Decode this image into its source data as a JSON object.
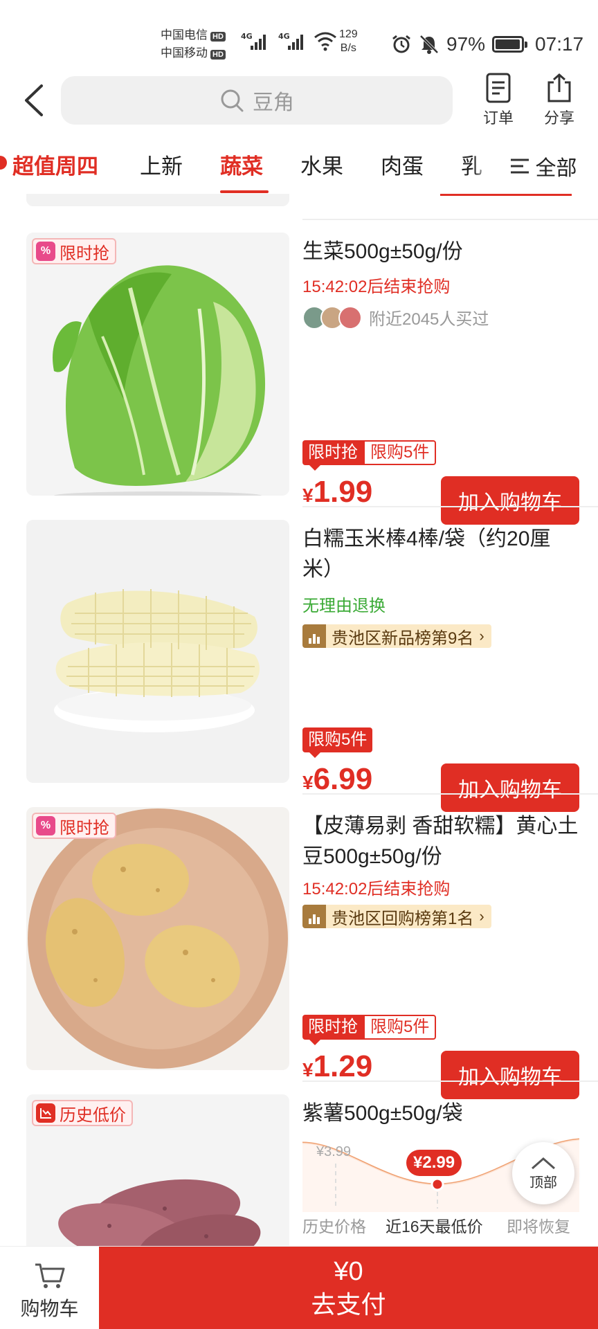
{
  "status": {
    "carrier1": "中国电信",
    "carrier2": "中国移动",
    "hd": "HD",
    "net": "4G",
    "speed_val": "129",
    "speed_unit": "B/s",
    "battery": "97%",
    "battery_level": 0.97,
    "time": "07:17"
  },
  "header": {
    "search_placeholder": "豆角",
    "orders_label": "订单",
    "share_label": "分享"
  },
  "tabs": [
    "超值周四",
    "上新",
    "蔬菜",
    "水果",
    "肉蛋",
    "乳"
  ],
  "active_tab": "蔬菜",
  "all_label": "全部",
  "products": [
    {
      "tag": "限时抢",
      "title": "生菜500g±50g/份",
      "countdown": "15:42:02后结束抢购",
      "buyers": "附近2045人买过",
      "badge1": "限时抢",
      "badge2": "限购5件",
      "currency": "¥",
      "price": "1.99",
      "button": "加入购物车"
    },
    {
      "title": "白糯玉米棒4棒/袋（约20厘米）",
      "note": "无理由退换",
      "rank": "贵池区新品榜第9名",
      "badge1": "限购5件",
      "currency": "¥",
      "price": "6.99",
      "button": "加入购物车"
    },
    {
      "tag": "限时抢",
      "title": "【皮薄易剥 香甜软糯】黄心土豆500g±50g/份",
      "countdown": "15:42:02后结束抢购",
      "rank": "贵池区回购榜第1名",
      "badge1": "限时抢",
      "badge2": "限购5件",
      "currency": "¥",
      "price": "1.29",
      "button": "加入购物车"
    },
    {
      "tag": "历史低价",
      "title": "紫薯500g±50g/袋",
      "old_price": "¥3.99",
      "low_price": "¥2.99",
      "label_history": "历史价格",
      "label_low": "近16天最低价",
      "label_restore": "即将恢复"
    }
  ],
  "top_label": "顶部",
  "bottom": {
    "cart_label": "购物车",
    "amount": "¥0",
    "pay_label": "去支付"
  },
  "colors": {
    "accent": "#e02e24",
    "green": "#3aaa35"
  }
}
